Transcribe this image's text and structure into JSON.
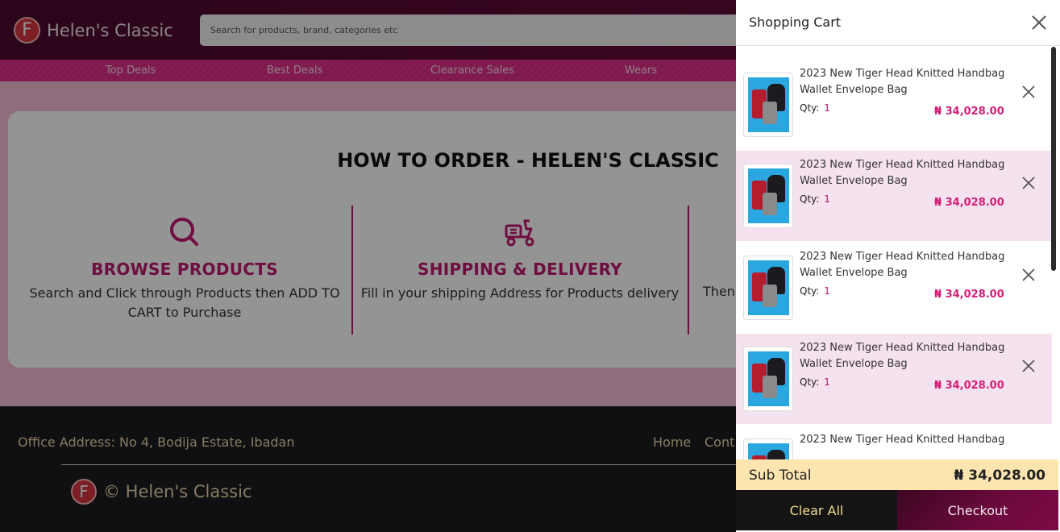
{
  "header": {
    "logo_letter": "F",
    "brand": "Helen's Classic",
    "search_placeholder": "Search for products, brand, categories etc"
  },
  "nav": [
    "Top Deals",
    "Best Deals",
    "Clearance Sales",
    "Wears"
  ],
  "how_to_order": {
    "title": "HOW TO ORDER - HELEN'S CLASSIC",
    "steps": [
      {
        "icon": "search-icon",
        "title": "BROWSE PRODUCTS",
        "desc": "Search and Click through Products then ADD TO CART to Purchase"
      },
      {
        "icon": "delivery-scooter-icon",
        "title": "SHIPPING & DELIVERY",
        "desc": "Fill in your shipping Address for Products delivery"
      }
    ],
    "third_step_partial": "Then"
  },
  "footer": {
    "address": "Office Address: No 4, Bodija Estate, Ibadan",
    "links": [
      "Home",
      "Cont"
    ],
    "copyright": "© Helen's Classic"
  },
  "cart": {
    "title": "Shopping Cart",
    "items": [
      {
        "name": "2023 New Tiger Head Knitted Handbag Wallet Envelope Bag",
        "qty_label": "Qty:",
        "qty": "1",
        "price": "₦ 34,028.00"
      },
      {
        "name": "2023 New Tiger Head Knitted Handbag Wallet Envelope Bag",
        "qty_label": "Qty:",
        "qty": "1",
        "price": "₦ 34,028.00"
      },
      {
        "name": "2023 New Tiger Head Knitted Handbag Wallet Envelope Bag",
        "qty_label": "Qty:",
        "qty": "1",
        "price": "₦ 34,028.00"
      },
      {
        "name": "2023 New Tiger Head Knitted Handbag Wallet Envelope Bag",
        "qty_label": "Qty:",
        "qty": "1",
        "price": "₦ 34,028.00"
      },
      {
        "name": "2023 New Tiger Head Knitted Handbag",
        "qty_label": "",
        "qty": "",
        "price": ""
      }
    ],
    "subtotal_label": "Sub Total",
    "subtotal_value": "₦ 34,028.00",
    "clear_label": "Clear All",
    "checkout_label": "Checkout"
  },
  "colors": {
    "brand_dark": "#5a0a33",
    "accent_pink": "#d41f78",
    "subtotal_bg": "#fde5b0",
    "clear_text": "#f3d98b"
  }
}
